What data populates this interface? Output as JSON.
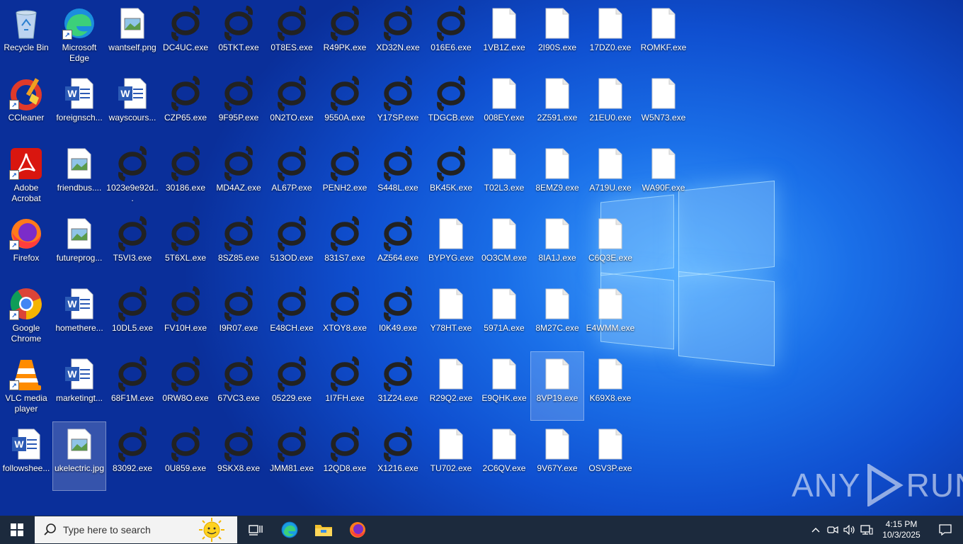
{
  "desktop": {
    "icons": [
      {
        "label": "Recycle Bin",
        "type": "recycle",
        "col": 0,
        "row": 0
      },
      {
        "label": "Microsoft Edge",
        "type": "edge",
        "col": 1,
        "row": 0,
        "shortcut": true
      },
      {
        "label": "wantself.png",
        "type": "image",
        "col": 2,
        "row": 0
      },
      {
        "label": "DC4UC.exe",
        "type": "exe",
        "col": 3,
        "row": 0
      },
      {
        "label": "05TKT.exe",
        "type": "exe",
        "col": 4,
        "row": 0
      },
      {
        "label": "0T8ES.exe",
        "type": "exe",
        "col": 5,
        "row": 0
      },
      {
        "label": "R49PK.exe",
        "type": "exe",
        "col": 6,
        "row": 0
      },
      {
        "label": "XD32N.exe",
        "type": "exe",
        "col": 7,
        "row": 0
      },
      {
        "label": "016E6.exe",
        "type": "exe",
        "col": 8,
        "row": 0
      },
      {
        "label": "1VB1Z.exe",
        "type": "blank",
        "col": 9,
        "row": 0
      },
      {
        "label": "2I90S.exe",
        "type": "blank",
        "col": 10,
        "row": 0
      },
      {
        "label": "17DZ0.exe",
        "type": "blank",
        "col": 11,
        "row": 0
      },
      {
        "label": "ROMKF.exe",
        "type": "blank",
        "col": 12,
        "row": 0
      },
      {
        "label": "CCleaner",
        "type": "ccleaner",
        "col": 0,
        "row": 1,
        "shortcut": true
      },
      {
        "label": "foreignsch...",
        "type": "word",
        "col": 1,
        "row": 1
      },
      {
        "label": "wayscours...",
        "type": "word",
        "col": 2,
        "row": 1
      },
      {
        "label": "CZP65.exe",
        "type": "exe",
        "col": 3,
        "row": 1
      },
      {
        "label": "9F95P.exe",
        "type": "exe",
        "col": 4,
        "row": 1
      },
      {
        "label": "0N2TO.exe",
        "type": "exe",
        "col": 5,
        "row": 1
      },
      {
        "label": "9550A.exe",
        "type": "exe",
        "col": 6,
        "row": 1
      },
      {
        "label": "Y17SP.exe",
        "type": "exe",
        "col": 7,
        "row": 1
      },
      {
        "label": "TDGCB.exe",
        "type": "exe",
        "col": 8,
        "row": 1
      },
      {
        "label": "008EY.exe",
        "type": "blank",
        "col": 9,
        "row": 1
      },
      {
        "label": "2Z591.exe",
        "type": "blank",
        "col": 10,
        "row": 1
      },
      {
        "label": "21EU0.exe",
        "type": "blank",
        "col": 11,
        "row": 1
      },
      {
        "label": "W5N73.exe",
        "type": "blank",
        "col": 12,
        "row": 1
      },
      {
        "label": "Adobe Acrobat",
        "type": "acrobat",
        "col": 0,
        "row": 2,
        "shortcut": true
      },
      {
        "label": "friendbus....",
        "type": "image",
        "col": 1,
        "row": 2
      },
      {
        "label": "1023e9e92d...",
        "type": "exe",
        "col": 2,
        "row": 2
      },
      {
        "label": "30186.exe",
        "type": "exe",
        "col": 3,
        "row": 2
      },
      {
        "label": "MD4AZ.exe",
        "type": "exe",
        "col": 4,
        "row": 2
      },
      {
        "label": "AL67P.exe",
        "type": "exe",
        "col": 5,
        "row": 2
      },
      {
        "label": "PENH2.exe",
        "type": "exe",
        "col": 6,
        "row": 2
      },
      {
        "label": "S448L.exe",
        "type": "exe",
        "col": 7,
        "row": 2
      },
      {
        "label": "BK45K.exe",
        "type": "exe",
        "col": 8,
        "row": 2
      },
      {
        "label": "T02L3.exe",
        "type": "blank",
        "col": 9,
        "row": 2
      },
      {
        "label": "8EMZ9.exe",
        "type": "blank",
        "col": 10,
        "row": 2
      },
      {
        "label": "A719U.exe",
        "type": "blank",
        "col": 11,
        "row": 2
      },
      {
        "label": "WA90F.exe",
        "type": "blank",
        "col": 12,
        "row": 2
      },
      {
        "label": "Firefox",
        "type": "firefox",
        "col": 0,
        "row": 3,
        "shortcut": true
      },
      {
        "label": "futureprog...",
        "type": "image",
        "col": 1,
        "row": 3
      },
      {
        "label": "T5VI3.exe",
        "type": "exe",
        "col": 2,
        "row": 3
      },
      {
        "label": "5T6XL.exe",
        "type": "exe",
        "col": 3,
        "row": 3
      },
      {
        "label": "8SZ85.exe",
        "type": "exe",
        "col": 4,
        "row": 3
      },
      {
        "label": "513OD.exe",
        "type": "exe",
        "col": 5,
        "row": 3
      },
      {
        "label": "831S7.exe",
        "type": "exe",
        "col": 6,
        "row": 3
      },
      {
        "label": "AZ564.exe",
        "type": "exe",
        "col": 7,
        "row": 3
      },
      {
        "label": "BYPYG.exe",
        "type": "blank",
        "col": 8,
        "row": 3
      },
      {
        "label": "0O3CM.exe",
        "type": "blank",
        "col": 9,
        "row": 3
      },
      {
        "label": "8IA1J.exe",
        "type": "blank",
        "col": 10,
        "row": 3
      },
      {
        "label": "C6Q3E.exe",
        "type": "blank",
        "col": 11,
        "row": 3
      },
      {
        "label": "Google Chrome",
        "type": "chrome",
        "col": 0,
        "row": 4,
        "shortcut": true
      },
      {
        "label": "homethere...",
        "type": "word",
        "col": 1,
        "row": 4
      },
      {
        "label": "10DL5.exe",
        "type": "exe",
        "col": 2,
        "row": 4
      },
      {
        "label": "FV10H.exe",
        "type": "exe",
        "col": 3,
        "row": 4
      },
      {
        "label": "I9R07.exe",
        "type": "exe",
        "col": 4,
        "row": 4
      },
      {
        "label": "E48CH.exe",
        "type": "exe",
        "col": 5,
        "row": 4
      },
      {
        "label": "XTOY8.exe",
        "type": "exe",
        "col": 6,
        "row": 4
      },
      {
        "label": "I0K49.exe",
        "type": "exe",
        "col": 7,
        "row": 4
      },
      {
        "label": "Y78HT.exe",
        "type": "blank",
        "col": 8,
        "row": 4
      },
      {
        "label": "5971A.exe",
        "type": "blank",
        "col": 9,
        "row": 4
      },
      {
        "label": "8M27C.exe",
        "type": "blank",
        "col": 10,
        "row": 4
      },
      {
        "label": "E4WMM.exe",
        "type": "blank",
        "col": 11,
        "row": 4
      },
      {
        "label": "VLC media player",
        "type": "vlc",
        "col": 0,
        "row": 5,
        "shortcut": true
      },
      {
        "label": "marketingt...",
        "type": "word",
        "col": 1,
        "row": 5
      },
      {
        "label": "68F1M.exe",
        "type": "exe",
        "col": 2,
        "row": 5
      },
      {
        "label": "0RW8O.exe",
        "type": "exe",
        "col": 3,
        "row": 5
      },
      {
        "label": "67VC3.exe",
        "type": "exe",
        "col": 4,
        "row": 5
      },
      {
        "label": "05229.exe",
        "type": "exe",
        "col": 5,
        "row": 5
      },
      {
        "label": "1I7FH.exe",
        "type": "exe",
        "col": 6,
        "row": 5
      },
      {
        "label": "31Z24.exe",
        "type": "exe",
        "col": 7,
        "row": 5
      },
      {
        "label": "R29Q2.exe",
        "type": "blank",
        "col": 8,
        "row": 5
      },
      {
        "label": "E9QHK.exe",
        "type": "blank",
        "col": 9,
        "row": 5
      },
      {
        "label": "8VP19.exe",
        "type": "blank",
        "col": 10,
        "row": 5,
        "selected": true
      },
      {
        "label": "K69X8.exe",
        "type": "blank",
        "col": 11,
        "row": 5
      },
      {
        "label": "followshee...",
        "type": "word",
        "col": 0,
        "row": 6
      },
      {
        "label": "ukelectric.jpg",
        "type": "image",
        "col": 1,
        "row": 6,
        "selected": true
      },
      {
        "label": "83092.exe",
        "type": "exe",
        "col": 2,
        "row": 6
      },
      {
        "label": "0U859.exe",
        "type": "exe",
        "col": 3,
        "row": 6
      },
      {
        "label": "9SKX8.exe",
        "type": "exe",
        "col": 4,
        "row": 6
      },
      {
        "label": "JMM81.exe",
        "type": "exe",
        "col": 5,
        "row": 6
      },
      {
        "label": "12QD8.exe",
        "type": "exe",
        "col": 6,
        "row": 6
      },
      {
        "label": "X1216.exe",
        "type": "exe",
        "col": 7,
        "row": 6
      },
      {
        "label": "TU702.exe",
        "type": "blank",
        "col": 8,
        "row": 6
      },
      {
        "label": "2C6QV.exe",
        "type": "blank",
        "col": 9,
        "row": 6
      },
      {
        "label": "9V67Y.exe",
        "type": "blank",
        "col": 10,
        "row": 6
      },
      {
        "label": "OSV3P.exe",
        "type": "blank",
        "col": 11,
        "row": 6
      }
    ]
  },
  "watermark": {
    "left": "ANY",
    "right": "RUN"
  },
  "taskbar": {
    "search_placeholder": "Type here to search",
    "apps": [
      "task-view-icon",
      "edge-icon",
      "file-explorer-icon",
      "firefox-icon"
    ],
    "clock_time": "4:15 PM",
    "clock_date": "10/3/2025"
  },
  "colors": {
    "taskbar": "#1c2a3d",
    "exe_icon": "#222222"
  }
}
